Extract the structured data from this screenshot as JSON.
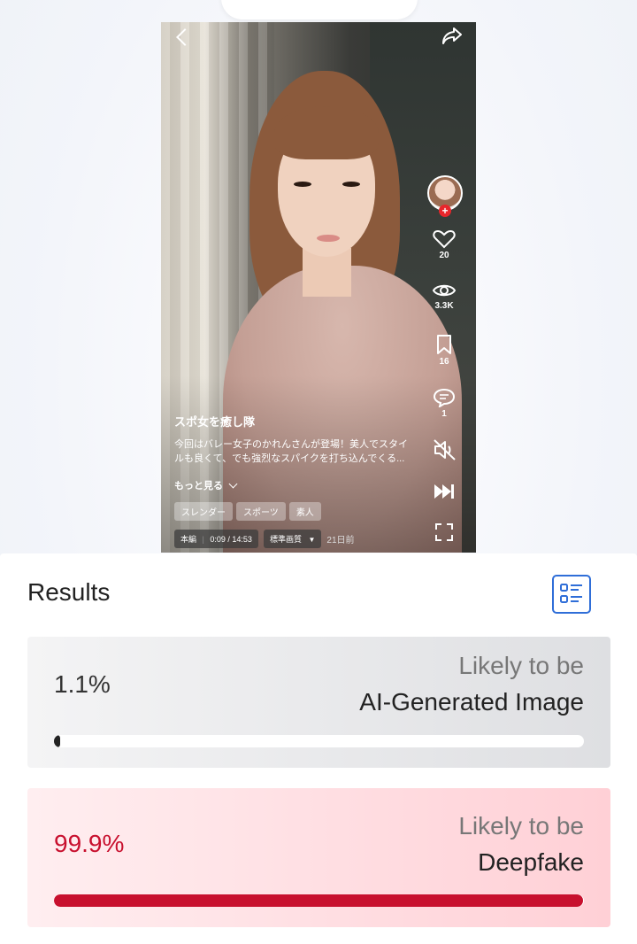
{
  "video": {
    "title": "スポ女を癒し隊",
    "description": "今回はバレー女子のかれんさんが登場！美人でスタイルも良くて、でも強烈なスパイクを打ち込んでくる...",
    "more_label": "もっと見る",
    "tags": [
      "スレンダー",
      "スポーツ",
      "素人"
    ],
    "episode_label": "本編",
    "time_label": "0:09 / 14:53",
    "quality_label": "標準画質",
    "posted": "21日前",
    "likes": "20",
    "views": "3.3K",
    "bookmarks": "16",
    "comments": "1"
  },
  "results": {
    "title": "Results",
    "cards": [
      {
        "percent": "1.1%",
        "likely": "Likely to be",
        "label": "AI-Generated Image",
        "value": 0.011
      },
      {
        "percent": "99.9%",
        "likely": "Likely to be",
        "label": "Deepfake",
        "value": 0.999
      }
    ]
  },
  "icons": [
    "chevron-down-icon",
    "back-icon",
    "share-icon",
    "heart-icon",
    "eye-icon",
    "bookmark-icon",
    "comment-icon",
    "mute-icon",
    "skip-icon",
    "fullscreen-icon",
    "list-icon"
  ],
  "colors": {
    "accent_blue": "#2f6ed8",
    "deepfake_red": "#c8102e"
  }
}
